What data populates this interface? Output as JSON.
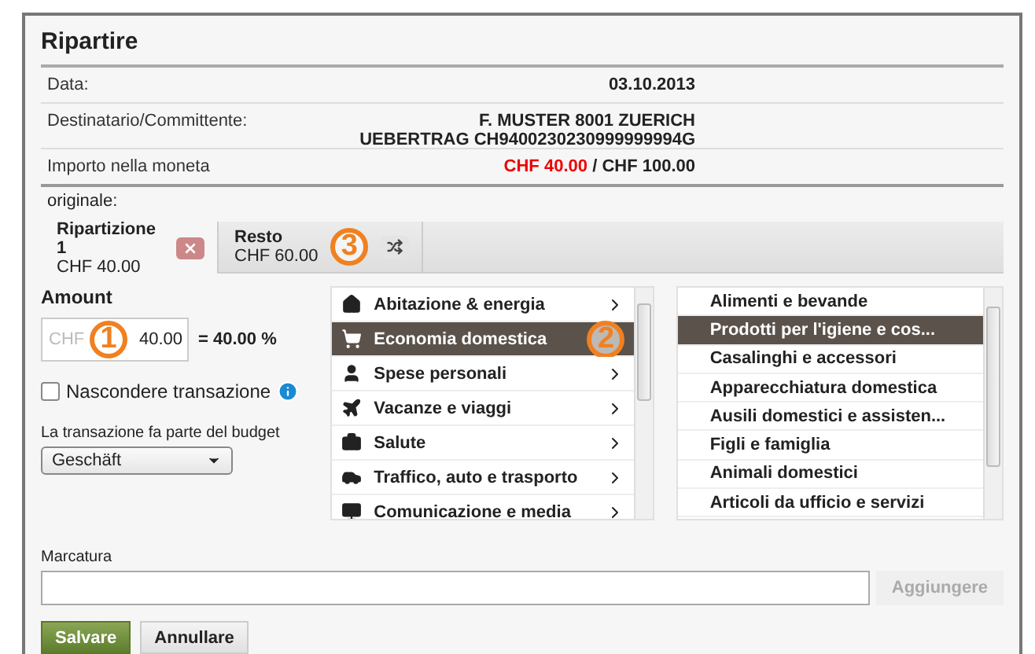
{
  "title": "Ripartire",
  "details": [
    {
      "kind": "text",
      "label": "Data:",
      "lines": [
        "03.10.2013"
      ]
    },
    {
      "kind": "text",
      "label": "Destinatario/Committente:",
      "lines": [
        "F. MUSTER 8001 ZUERICH",
        "UEBERTRAG CH9400230230999999994G"
      ]
    },
    {
      "kind": "amount",
      "label": "Importo nella moneta",
      "amount": "CHF 40.00",
      "separator": "/",
      "total": "CHF 100.00"
    }
  ],
  "label_continuation": "originale:",
  "tabs": [
    {
      "title": "Ripartizione 1",
      "amount": "CHF 40.00",
      "selected": true,
      "kind": "part"
    },
    {
      "title": "Resto",
      "amount": "CHF 60.00",
      "selected": false,
      "kind": "rest",
      "callout": "3"
    }
  ],
  "amount": {
    "label": "Amount",
    "placeholder": "CHF",
    "value": "40.00",
    "percent": "= 40.00 %",
    "callout": "1"
  },
  "hide": {
    "label": "Nascondere transazione",
    "checked": false
  },
  "budget": {
    "label": "La transazione fa parte del budget",
    "value": "Geschäft"
  },
  "categories": [
    {
      "label": "Abitazione & energia",
      "selected": false
    },
    {
      "label": "Economia domestica",
      "selected": true,
      "callout": "2"
    },
    {
      "label": "Spese personali",
      "selected": false
    },
    {
      "label": "Vacanze e viaggi",
      "selected": false
    },
    {
      "label": "Salute",
      "selected": false
    },
    {
      "label": "Traffico, auto e trasporto",
      "selected": false
    },
    {
      "label": "Comunicazione e media",
      "selected": false
    }
  ],
  "subcategories": [
    {
      "label": "Alimenti e bevande",
      "selected": false
    },
    {
      "label": "Prodotti per l'igiene e cos...",
      "selected": true
    },
    {
      "label": "Casalinghi e accessori",
      "selected": false
    },
    {
      "label": "Apparecchiatura domestica",
      "selected": false
    },
    {
      "label": "Ausili domestici e assisten...",
      "selected": false
    },
    {
      "label": "Figli e famiglia",
      "selected": false
    },
    {
      "label": "Animali domestici",
      "selected": false
    },
    {
      "label": "Articoli da ufficio e servizi",
      "selected": false
    }
  ],
  "marking": {
    "label": "Marcatura",
    "add_button": "Aggiungere"
  },
  "buttons": [
    {
      "label": "Salvare",
      "kind": "primary"
    },
    {
      "label": "Annullare",
      "kind": "secondary"
    }
  ]
}
